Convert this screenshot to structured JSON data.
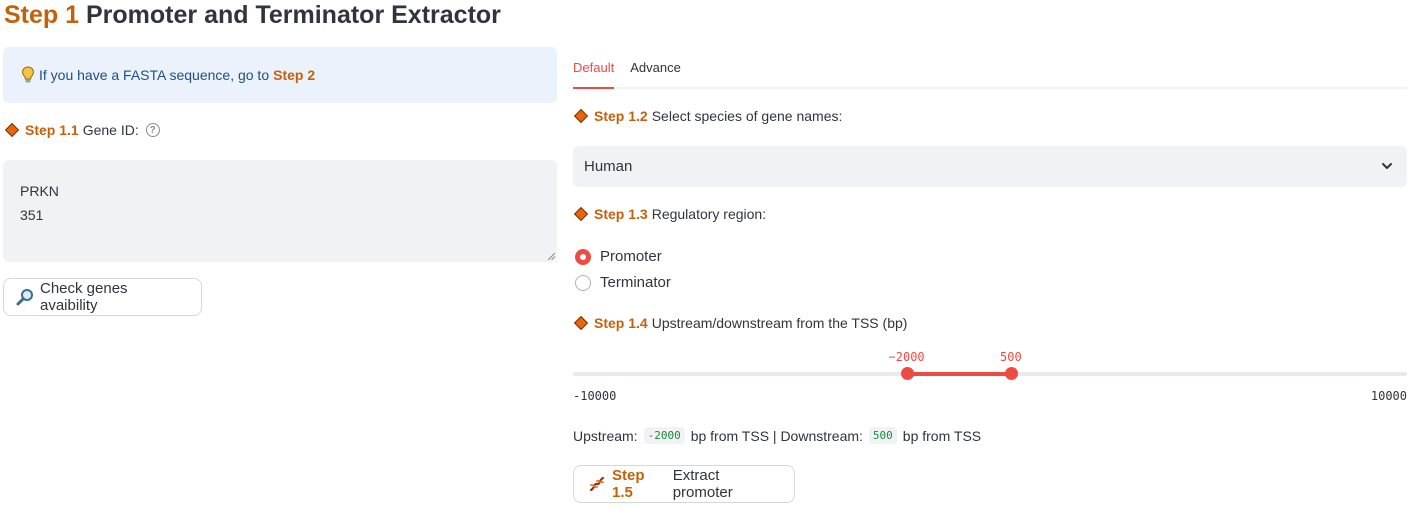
{
  "title": {
    "step": "Step 1",
    "text": "Promoter and Terminator Extractor"
  },
  "info": {
    "icon": "lightbulb-icon",
    "text": "If you have a FASTA sequence, go to",
    "step": "Step 2"
  },
  "gene_id": {
    "step": "Step 1.1",
    "label": "Gene ID:",
    "help": "?",
    "value": "PRKN\n351"
  },
  "check_button": {
    "icon": "magnifier-icon",
    "label": "Check genes avaibility"
  },
  "tabs": [
    {
      "label": "Default",
      "active": true
    },
    {
      "label": "Advance",
      "active": false
    }
  ],
  "species": {
    "step": "Step 1.2",
    "label": "Select species of gene names:",
    "value": "Human"
  },
  "region": {
    "step": "Step 1.3",
    "label": "Regulatory region:",
    "options": [
      "Promoter",
      "Terminator"
    ],
    "selected": "Promoter"
  },
  "range": {
    "step": "Step 1.4",
    "label": "Upstream/downstream from the TSS (bp)",
    "min": -10000,
    "max": 10000,
    "low": -2000,
    "high": 500,
    "min_label": "-10000",
    "max_label": "10000",
    "low_label": "−2000",
    "high_label": "500"
  },
  "summary": {
    "upstream_label": "Upstream:",
    "upstream_value": "-2000",
    "mid": "bp from TSS | Downstream:",
    "downstream_value": "500",
    "end": "bp from TSS"
  },
  "extract_button": {
    "icon": "dna-icon",
    "step": "Step 1.5",
    "label": "Extract promoter"
  },
  "colors": {
    "accent": "#ee4b44",
    "step": "#c5610a",
    "diamond": "#e8650c"
  }
}
